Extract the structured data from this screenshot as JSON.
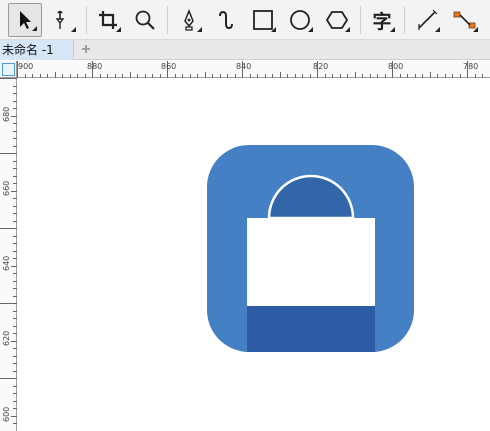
{
  "toolbar": {
    "tools": [
      {
        "name": "pick-tool",
        "icon": "arrow-pointer-icon",
        "active": true
      },
      {
        "name": "shape-tool",
        "icon": "node-edit-icon"
      },
      {
        "name": "crop-tool",
        "icon": "crop-icon"
      },
      {
        "name": "zoom-tool",
        "icon": "magnifier-icon"
      },
      {
        "name": "pen-tool",
        "icon": "pen-nib-icon"
      },
      {
        "name": "smart-drawing-tool",
        "icon": "curve-icon"
      },
      {
        "name": "rectangle-tool",
        "icon": "rectangle-icon"
      },
      {
        "name": "ellipse-tool",
        "icon": "ellipse-icon"
      },
      {
        "name": "polygon-tool",
        "icon": "hexagon-icon"
      },
      {
        "name": "text-tool",
        "icon": "text-glyph-icon",
        "glyph": "字"
      },
      {
        "name": "dimension-tool",
        "icon": "dimension-line-icon"
      },
      {
        "name": "connector-tool",
        "icon": "connector-icon"
      }
    ]
  },
  "document_tab": {
    "title": "未命名 -1",
    "add_symbol": "+"
  },
  "rulers": {
    "horizontal_labels": [
      "900",
      "880",
      "860",
      "840",
      "820",
      "800",
      "780"
    ],
    "vertical_labels": [
      "680",
      "660",
      "640",
      "620",
      "600"
    ]
  },
  "artwork": {
    "colors": {
      "background_tile": "#4580c4",
      "handle": "#3266a8",
      "bag_body": "#ffffff",
      "bag_bottom": "#2e5ba6",
      "ruler_accent": "#4a9cd8"
    }
  }
}
